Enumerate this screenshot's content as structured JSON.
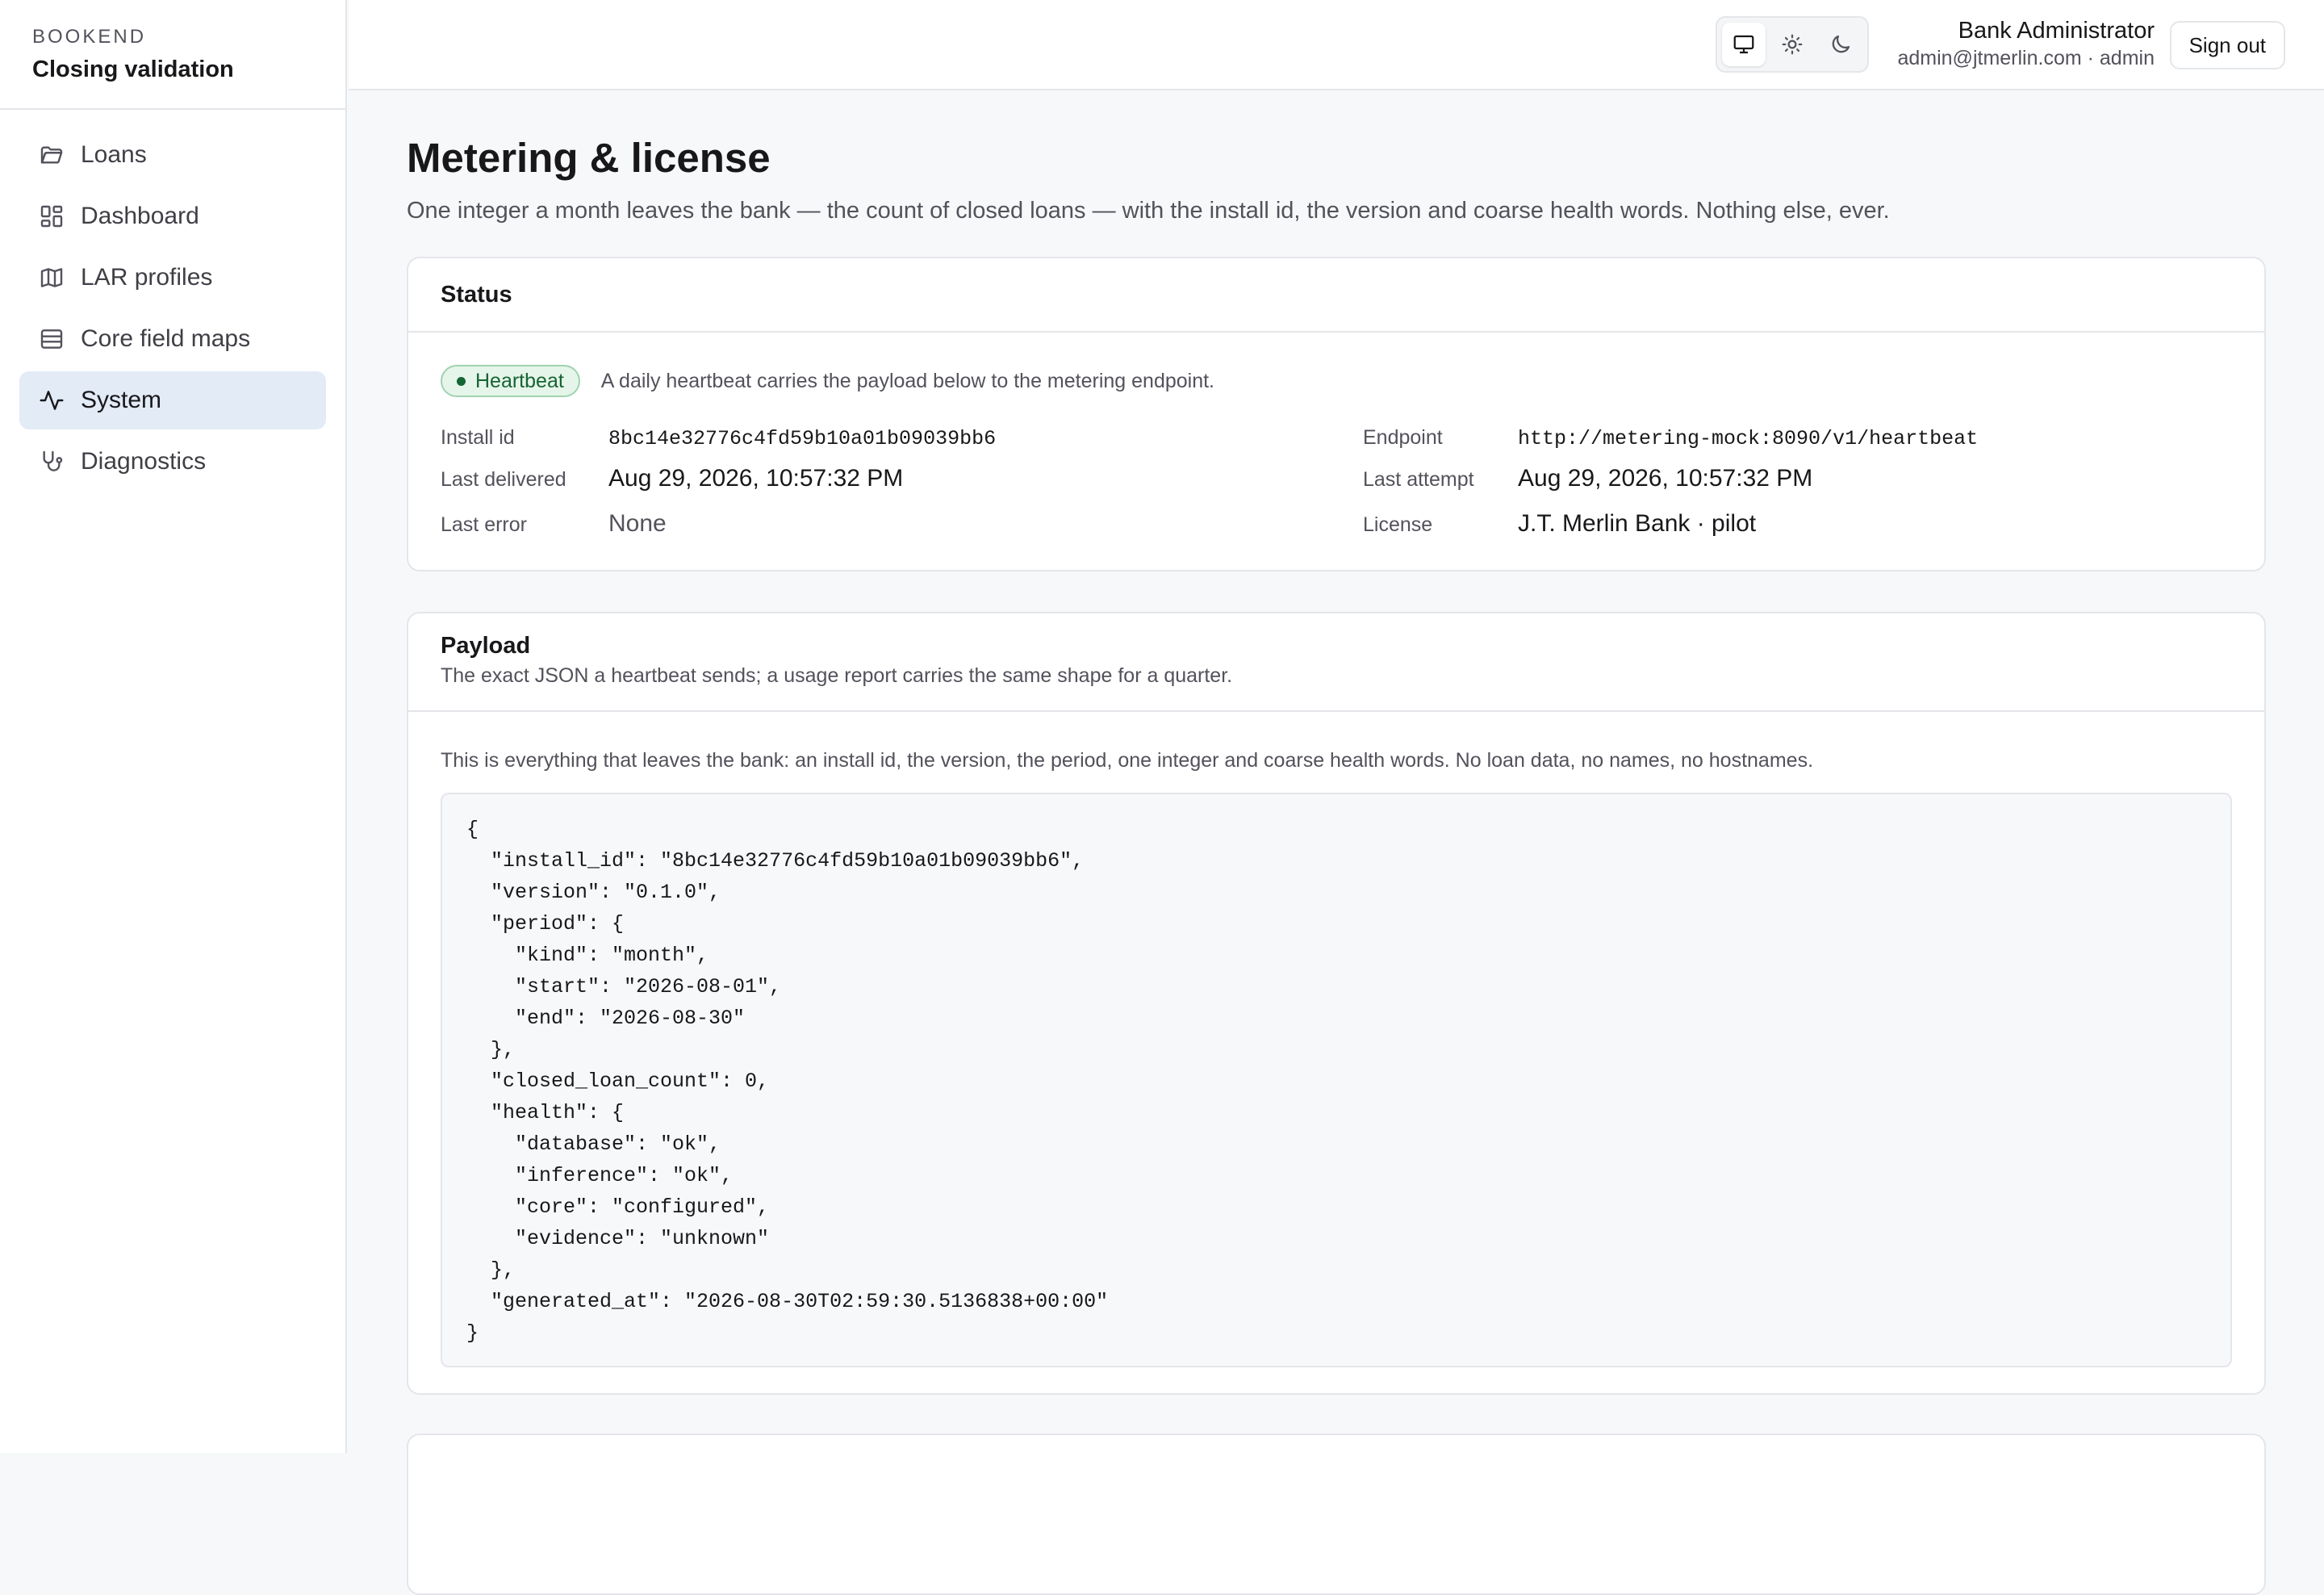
{
  "brand": {
    "name": "BOOKEND",
    "subtitle": "Closing validation"
  },
  "nav": [
    {
      "label": "Loans",
      "icon": "folder-icon",
      "active": false
    },
    {
      "label": "Dashboard",
      "icon": "dashboard-icon",
      "active": false
    },
    {
      "label": "LAR profiles",
      "icon": "map-icon",
      "active": false
    },
    {
      "label": "Core field maps",
      "icon": "table-icon",
      "active": false
    },
    {
      "label": "System",
      "icon": "activity-icon",
      "active": true
    },
    {
      "label": "Diagnostics",
      "icon": "stethoscope-icon",
      "active": false
    }
  ],
  "theme": {
    "options": [
      "system",
      "light",
      "dark"
    ],
    "selected": "system"
  },
  "user": {
    "name": "Bank Administrator",
    "email": "admin@jtmerlin.com · admin",
    "signout_label": "Sign out"
  },
  "page": {
    "title": "Metering & license",
    "description": "One integer a month leaves the bank — the count of closed loans — with the install id, the version and coarse health words. Nothing else, ever."
  },
  "status": {
    "title": "Status",
    "badge": "Heartbeat",
    "badge_text": "A daily heartbeat carries the payload below to the metering endpoint.",
    "install_id_label": "Install id",
    "install_id": "8bc14e32776c4fd59b10a01b09039bb6",
    "endpoint_label": "Endpoint",
    "endpoint": "http://metering-mock:8090/v1/heartbeat",
    "last_delivered_label": "Last delivered",
    "last_delivered": "Aug 29, 2026, 10:57:32 PM",
    "last_attempt_label": "Last attempt",
    "last_attempt": "Aug 29, 2026, 10:57:32 PM",
    "last_error_label": "Last error",
    "last_error": "None",
    "license_label": "License",
    "license": "J.T. Merlin Bank · pilot"
  },
  "payload": {
    "title": "Payload",
    "subtitle": "The exact JSON a heartbeat sends; a usage report carries the same shape for a quarter.",
    "note": "This is everything that leaves the bank: an install id, the version, the period, one integer and coarse health words. No loan data, no names, no hostnames.",
    "json_text": "{\n  \"install_id\": \"8bc14e32776c4fd59b10a01b09039bb6\",\n  \"version\": \"0.1.0\",\n  \"period\": {\n    \"kind\": \"month\",\n    \"start\": \"2026-08-01\",\n    \"end\": \"2026-08-30\"\n  },\n  \"closed_loan_count\": 0,\n  \"health\": {\n    \"database\": \"ok\",\n    \"inference\": \"ok\",\n    \"core\": \"configured\",\n    \"evidence\": \"unknown\"\n  },\n  \"generated_at\": \"2026-08-30T02:59:30.5136838+00:00\"\n}"
  }
}
